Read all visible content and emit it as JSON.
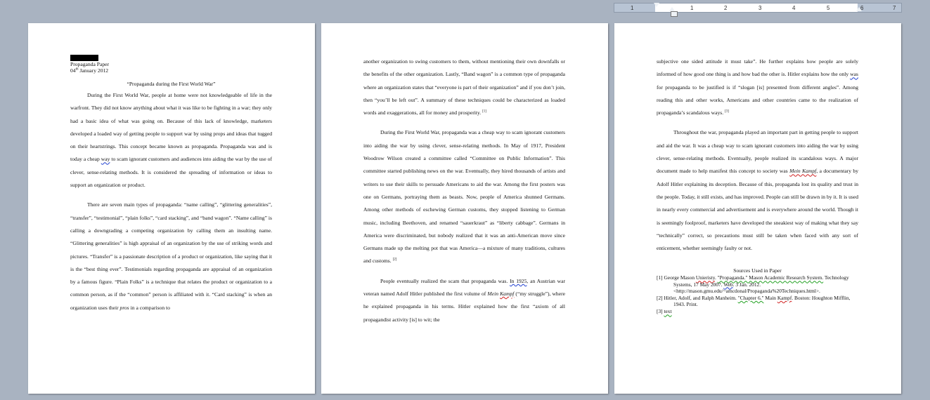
{
  "ruler": {
    "marks": [
      "1",
      "1",
      "2",
      "3",
      "4",
      "5",
      "6",
      "7"
    ]
  },
  "page1": {
    "header_line1": "Propaganda Paper",
    "header_line2_day": "04",
    "header_line2_sup": "th",
    "header_line2_rest": " January 2012",
    "title": "“Propaganda during the First World War”",
    "p1a": "During the First World War, people at home were not knowledgeable of life in the warfront.  They did not know anything about what it was like to be fighting in a war; they only had a basic idea of what was going on.  Because of this lack of knowledge, marketers developed a loaded way of getting people to support war by using props and ideas that tugged on their heartstrings.  This concept became known as propaganda.  Propaganda was and is today a cheap ",
    "p1_way": "way",
    "p1b": " to scam ignorant customers and audiences into aiding the war by the use of clever, sense-relating methods.  It is considered the spreading of information or ideas to support an organization or product.",
    "p2a": "There are seven main types of propaganda: “name calling”, “glittering generalities”, “transfer”, “testimonial”, “plain folks”, “card stacking”, and “band wagon”. “Name calling” is calling a downgrading a competing organization by calling them an insulting name.  “Glittering generalities” is high appraisal of an organization by the use of striking words and pictures.  “Transfer” is a passionate description of a product or organization, like saying that it is the “best thing ever”.  Testimonials regarding propaganda are appraisal of an organization by a famous figure.  “Plain Folks” is a technique that relates the product or organization to a common person, as if the “common” person is affiliated with it.  “Card stacking” is when an organization uses their ",
    "p2_pros": "pros",
    "p2b": " in a comparison to"
  },
  "page2": {
    "p1": "another organization to swing customers to them, without mentioning their own downfalls or the benefits of the other organization.  Lastly, “Band wagon” is a common type of propaganda where an organization states that “everyone is part of their organization” and if you don’t join, then “you’ll be left out”.  A summary of these techniques could be characterized as loaded words and exaggerations, all for money and prosperity.",
    "p1_ref": "[1]",
    "p2": "During the First World War, propaganda was a cheap way to scam ignorant customers into aiding the war by using clever, sense-relating methods.  In May of 1917, President Woodrow Wilson created a committee called “Committee on Public Information”. This committee started publishing news on the war.  Eventually, they hired thousands of artists and writers to use their skills to persuade Americans to aid the war.  Among the first posters was one on Germans, portraying them as beasts.  Now, people of America shunned Germans.  Among other methods of eschewing German customs, they stopped listening to German music, including Beethoven, and renamed “sauerkraut” as “liberty cabbage”.  Germans in America were discriminated, but nobody realized that it was an anti-American move since Germans made up the melting pot that was America—a mixture of many traditions, cultures and customs.",
    "p2_ref": "[2]",
    "p3a": "People eventually realized the scam that propaganda was.  ",
    "p3_in1925": "In  1925",
    "p3b": ", an Austrian war veteran named Adolf Hitler published the first volume of ",
    "p3_mein": "Mein",
    "p3_kampf": "Kampf",
    "p3c": " (“my struggle”), where he explained propaganda in his terms.  Hitler explained how the first “axiom of all propagandist activity [is] to wit; the"
  },
  "page3": {
    "p1a": "subjective one sided attitude it must take”.   He further explains how people are solely informed of how good one thing is and how bad the other is.  Hitler explains how the only ",
    "p1_was": "was",
    "p1b": " for propaganda to be justified is if “slogan [is] presented from different angles”.   Among reading this and other works, Americans and other countries came to the realization of propaganda’s scandalous ways.",
    "p1_ref": "[3]",
    "p2a": "Throughout the war, propaganda played an important part in getting people to support and aid the war.  It was a cheap way to scam ignorant customers into aiding the war by using clever, sense-relating methods.  Eventually, people realized its scandalous ways.  A major document made to help manifest this concept to society was ",
    "p2_meinkampf": "Mein Kampf",
    "p2b": ", a documentary by Adolf Hitler explaining its deception. Because of this, propaganda lost its quality and trust in the people.  Today, it still exists, and has improved.  People can still be drawn in by it.  It is used in nearly every commercial and advertisement and is everywhere around the world.  Though it is seemingly foolproof, marketers have developed the sneakiest way of making what they say “technically” correct, so precautions must still be taken when faced with any sort of enticement, whether seemingly  faulty or not.",
    "sources_title": "Sources Used in Paper",
    "src1_a": "[1] George Mason ",
    "src1_univ": "Unieristy",
    "src1_b": ". ",
    "src1_prop": "\"Propaganda.\" Mason Academic Research System.",
    "src1_c": " Technology Systems, 17 May 2007. ",
    "src1_web": "Web",
    "src1_d": ". 3 Jan. 2012. <http://mason.gmu.edu/~amcdonal/Propaganda%20Techniques.html>.",
    "src2_a": "[2] Hitler, Adolf, and Ralph Manheim. ",
    "src2_ch": "\"Chapter 6.\"",
    "src2_b": " Main ",
    "src2_kampf": "Kampf",
    "src2_c": ". Boston: Houghton Mifflin, 1943. Print.",
    "src3_a": "[3] ",
    "src3_text": "text"
  }
}
